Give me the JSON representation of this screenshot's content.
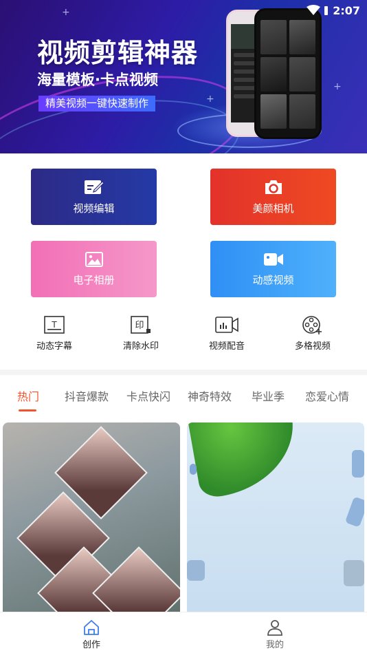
{
  "status_bar": {
    "time": "2:07"
  },
  "banner": {
    "title": "视频剪辑神器",
    "subtitle": "海量模板·卡点视频",
    "tagline": "精美视频一键快速制作"
  },
  "main_actions": [
    {
      "label": "视频编辑",
      "icon": "edit-icon"
    },
    {
      "label": "美颜相机",
      "icon": "camera-icon"
    },
    {
      "label": "电子相册",
      "icon": "image-icon"
    },
    {
      "label": "动感视频",
      "icon": "video-camera-icon"
    }
  ],
  "tools": [
    {
      "label": "动态字幕",
      "icon": "subtitles-icon"
    },
    {
      "label": "清除水印",
      "icon": "watermark-icon"
    },
    {
      "label": "视频配音",
      "icon": "dubbing-icon"
    },
    {
      "label": "多格视频",
      "icon": "film-reel-icon"
    }
  ],
  "category_tabs": [
    "热门",
    "抖音爆款",
    "卡点快闪",
    "神奇特效",
    "毕业季",
    "恋爱心情"
  ],
  "active_tab": "热门",
  "bottom_nav": [
    {
      "label": "创作",
      "icon": "home-icon",
      "active": true
    },
    {
      "label": "我的",
      "icon": "user-icon",
      "active": false
    }
  ],
  "colors": {
    "accent": "#f2532d",
    "video_edit": "#2d2a86",
    "beauty_camera": "#e3322b",
    "photo_album": "#f26fb6",
    "motion_video": "#2f8ff5",
    "nav_active": "#3f7de8"
  }
}
